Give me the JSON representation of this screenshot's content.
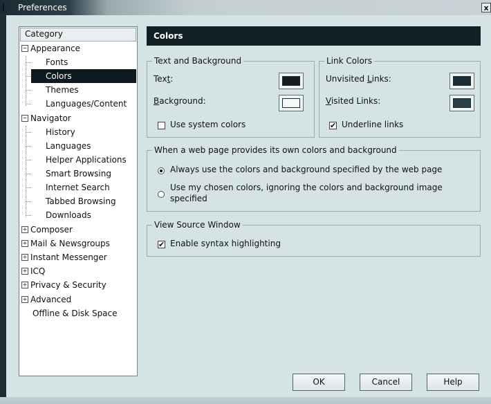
{
  "window": {
    "title": "Preferences",
    "close_label": "x"
  },
  "category": {
    "header": "Category",
    "items": [
      {
        "label": "Appearance",
        "expander": "−"
      },
      {
        "label": "Fonts"
      },
      {
        "label": "Colors"
      },
      {
        "label": "Themes"
      },
      {
        "label": "Languages/Content"
      },
      {
        "label": "Navigator",
        "expander": "−"
      },
      {
        "label": "History"
      },
      {
        "label": "Languages"
      },
      {
        "label": "Helper Applications"
      },
      {
        "label": "Smart Browsing"
      },
      {
        "label": "Internet Search"
      },
      {
        "label": "Tabbed Browsing"
      },
      {
        "label": "Downloads"
      },
      {
        "label": "Composer",
        "expander": "+"
      },
      {
        "label": "Mail & Newsgroups",
        "expander": "+"
      },
      {
        "label": "Instant Messenger",
        "expander": "+"
      },
      {
        "label": "ICQ",
        "expander": "+"
      },
      {
        "label": "Privacy & Security",
        "expander": "+"
      },
      {
        "label": "Advanced",
        "expander": "+"
      },
      {
        "label": "Offline & Disk Space"
      }
    ],
    "selected": "Colors"
  },
  "panel": {
    "title": "Colors",
    "text_background": {
      "title": "Text and Background",
      "text_label_pre": "Tex",
      "text_label_key": "t",
      "text_label_post": ":",
      "background_label_key": "B",
      "background_label_post": "ackground:",
      "text_color": "#141c20",
      "background_color": "#f4f8f8",
      "use_system_colors": "Use system colors",
      "use_system_checked": false
    },
    "link_colors": {
      "title": "Link Colors",
      "unvisited_pre": "Unvisited ",
      "unvisited_key": "L",
      "unvisited_post": "inks:",
      "visited_key": "V",
      "visited_post": "isited Links:",
      "unvisited_color": "#1b2e36",
      "visited_color": "#2a3f47",
      "underline_links": "Underline links",
      "underline_checked": true,
      "check_mark": "✔"
    },
    "web_page_colors": {
      "title": "When a web page provides its own colors and background",
      "option1": "Always use the colors and background specified by the web page",
      "option2_line1": "Use my chosen colors, ignoring the colors and background image",
      "option2_line2": "specified",
      "selected_option": 1
    },
    "view_source": {
      "title": "View Source Window",
      "syntax_highlighting": "Enable syntax highlighting",
      "syntax_checked": true,
      "check_mark": "✔"
    }
  },
  "buttons": {
    "ok": "OK",
    "cancel": "Cancel",
    "help": "Help"
  }
}
